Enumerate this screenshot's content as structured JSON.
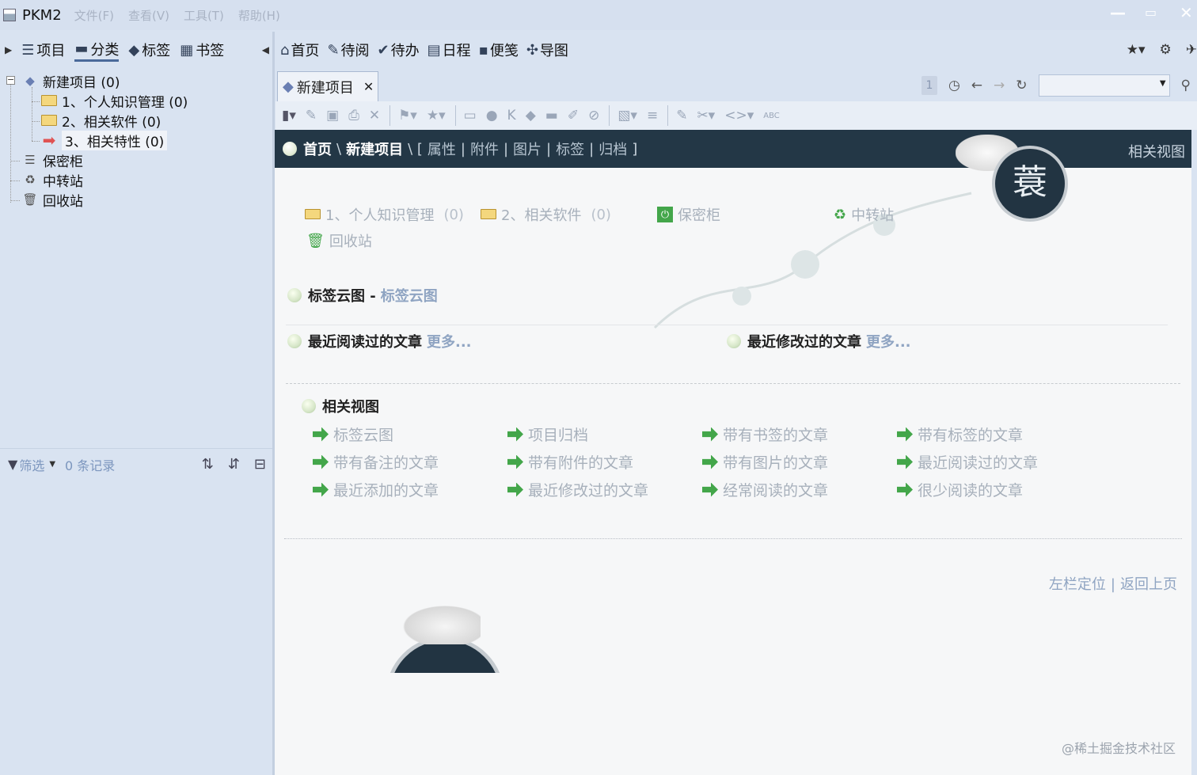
{
  "window": {
    "title": "PKM2",
    "menu": [
      "文件(F)",
      "查看(V)",
      "工具(T)",
      "帮助(H)"
    ]
  },
  "left_toolbar": {
    "items": [
      {
        "label": "项目",
        "icon": "list-icon"
      },
      {
        "label": "分类",
        "icon": "folder-icon"
      },
      {
        "label": "标签",
        "icon": "tag-icon"
      },
      {
        "label": "书签",
        "icon": "grid-icon"
      }
    ]
  },
  "tree": {
    "root": {
      "label": "新建项目 (0)"
    },
    "children": [
      {
        "label": "1、个人知识管理 (0)"
      },
      {
        "label": "2、相关软件 (0)"
      },
      {
        "label": "3、相关特性 (0)"
      }
    ],
    "extras": [
      {
        "label": "保密柜"
      },
      {
        "label": "中转站"
      },
      {
        "label": "回收站"
      }
    ]
  },
  "left_footer": {
    "filter_label": "筛选",
    "record_count": "0 条记录"
  },
  "main_toolbar": {
    "items": [
      {
        "label": "首页",
        "icon": "home-icon"
      },
      {
        "label": "待阅",
        "icon": "pin-icon"
      },
      {
        "label": "待办",
        "icon": "check-icon"
      },
      {
        "label": "日程",
        "icon": "calendar-icon"
      },
      {
        "label": "便笺",
        "icon": "note-icon"
      },
      {
        "label": "导图",
        "icon": "mindmap-icon"
      }
    ]
  },
  "tab": {
    "label": "新建项目"
  },
  "nav": {
    "page": "1"
  },
  "breadcrumb": {
    "home": "首页",
    "sep": "\\",
    "project": "新建项目",
    "open": "\\ [",
    "links": [
      "属性",
      "附件",
      "图片",
      "标签",
      "归档"
    ],
    "close": "]",
    "related": "相关视图"
  },
  "emblem": {
    "char": "蓑"
  },
  "shortcuts": [
    {
      "label": "1、个人知识管理",
      "count": "(0)"
    },
    {
      "label": "2、相关软件",
      "count": "(0)"
    },
    {
      "label": "保密柜"
    },
    {
      "label": "中转站"
    },
    {
      "label": "回收站"
    }
  ],
  "sections": {
    "tagcloud": {
      "title": "标签云图 -",
      "sub": "标签云图"
    },
    "recent_read": {
      "title": "最近阅读过的文章",
      "more": "更多..."
    },
    "recent_modified": {
      "title": "最近修改过的文章",
      "more": "更多..."
    },
    "related": {
      "title": "相关视图"
    }
  },
  "related_views": [
    [
      "标签云图",
      "项目归档",
      "带有书签的文章",
      "带有标签的文章"
    ],
    [
      "带有备注的文章",
      "带有附件的文章",
      "带有图片的文章",
      "最近阅读过的文章"
    ],
    [
      "最近添加的文章",
      "最近修改过的文章",
      "经常阅读的文章",
      "很少阅读的文章"
    ]
  ],
  "footer": {
    "locate": "左栏定位",
    "back": "返回上页"
  },
  "watermark": "@稀土掘金技术社区"
}
